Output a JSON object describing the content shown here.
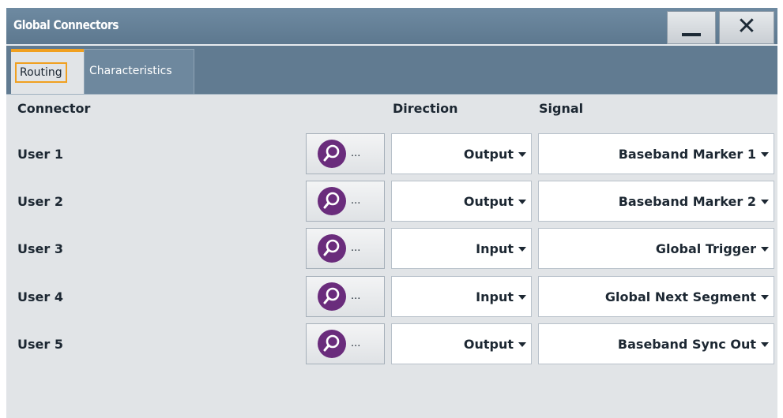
{
  "window": {
    "title": "Global Connectors",
    "minimize_icon": "minimize-icon",
    "close_icon": "close-icon"
  },
  "tabs": [
    {
      "label": "Routing",
      "active": true
    },
    {
      "label": "Characteristics",
      "active": false
    }
  ],
  "table": {
    "headers": {
      "connector": "Connector",
      "direction": "Direction",
      "signal": "Signal"
    },
    "select_icon": "magnifier-icon",
    "select_suffix": "...",
    "rows": [
      {
        "connector": "User 1",
        "direction": "Output",
        "signal": "Baseband Marker 1"
      },
      {
        "connector": "User 2",
        "direction": "Output",
        "signal": "Baseband Marker 2"
      },
      {
        "connector": "User 3",
        "direction": "Input",
        "signal": "Global Trigger"
      },
      {
        "connector": "User 4",
        "direction": "Input",
        "signal": "Global Next Segment"
      },
      {
        "connector": "User 5",
        "direction": "Output",
        "signal": "Baseband Sync Out"
      }
    ]
  },
  "colors": {
    "titlebar": "#617b91",
    "tab_accent": "#f0a020",
    "select_icon_bg": "#6a2c7c",
    "panel_bg": "#e1e4e7"
  }
}
